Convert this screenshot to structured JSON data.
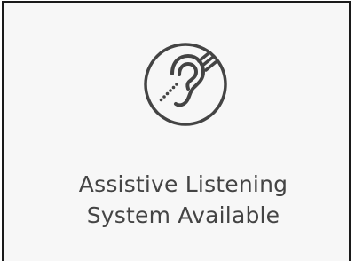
{
  "sign": {
    "icon": "assistive-listening-ear-icon",
    "caption_line1": "Assistive Listening",
    "caption_line2": "System Available"
  },
  "colors": {
    "background": "#f7f7f7",
    "border": "#1a1a1a",
    "icon": "#444444",
    "text": "#444444"
  }
}
